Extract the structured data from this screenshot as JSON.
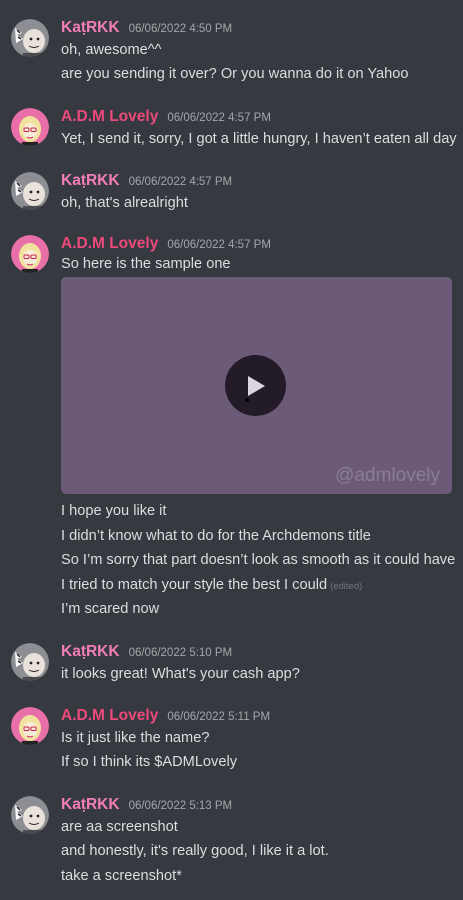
{
  "users": {
    "kat": {
      "name": "KaṭRKK",
      "color": "#f47fb8"
    },
    "adm": {
      "name": "A.D.M Lovely",
      "color": "#ed4a7b"
    }
  },
  "messages": [
    {
      "author": "KaṭRKK",
      "time": "06/06/2022 4:50 PM",
      "lines": [
        "oh, awesome^^",
        "are you sending it over? Or you wanna do it on Yahoo"
      ]
    },
    {
      "author": "A.D.M Lovely",
      "time": "06/06/2022 4:57 PM",
      "lines": [
        "Yet, I send it, sorry, I got a little hungry, I haven’t eaten all day"
      ]
    },
    {
      "author": "KaṭRKK",
      "time": "06/06/2022 4:57 PM",
      "lines": [
        "oh, that's alrealright"
      ]
    },
    {
      "author": "A.D.M Lovely",
      "time": "06/06/2022 4:57 PM",
      "lines": [
        "So here is the sample one"
      ],
      "video": {
        "watermark": "@admlovely"
      },
      "after_lines": [
        "I hope you like it",
        "I didn’t know what to do for the Archdemons title",
        "So I’m sorry that part doesn’t look as smooth as it could have",
        "I tried to match your style the best I could",
        "I’m scared now"
      ],
      "edited_label": "(edited)"
    },
    {
      "author": "KaṭRKK",
      "time": "06/06/2022 5:10 PM",
      "lines": [
        "it looks great! What's your cash app?"
      ]
    },
    {
      "author": "A.D.M Lovely",
      "time": "06/06/2022 5:11 PM",
      "lines": [
        "Is it just like the name?",
        "If so I think its $ADMLovely"
      ]
    },
    {
      "author": "KaṭRKK",
      "time": "06/06/2022 5:13 PM",
      "lines": [
        "are aa screenshot",
        "and honestly, it's really good, I like it a lot.",
        "take a screenshot*"
      ]
    }
  ]
}
